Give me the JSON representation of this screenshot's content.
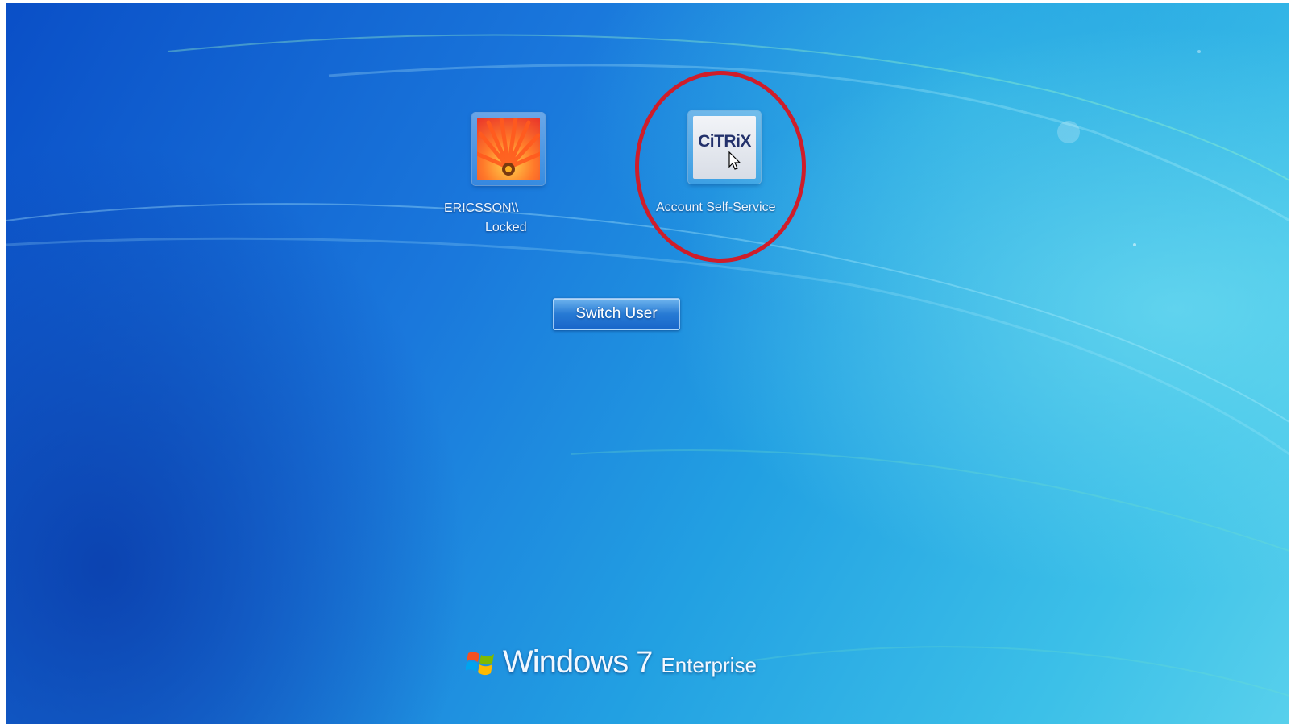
{
  "users": [
    {
      "name": "ERICSSON\\\\",
      "status": "Locked",
      "icon": "flower-avatar"
    },
    {
      "name": "Account Self-Service",
      "icon": "citrix-logo",
      "logo_text": "CiTRiX"
    }
  ],
  "switch_user_label": "Switch User",
  "branding": {
    "product": "Windows",
    "version": "7",
    "edition": "Enterprise",
    "icon": "windows-flag-icon"
  },
  "annotation": {
    "type": "red-circle",
    "color": "#cf1d2a",
    "target": "Account Self-Service"
  },
  "colors": {
    "background_dark": "#0a4fc7",
    "background_light": "#58d0ec",
    "ring": "#cf1d2a"
  }
}
